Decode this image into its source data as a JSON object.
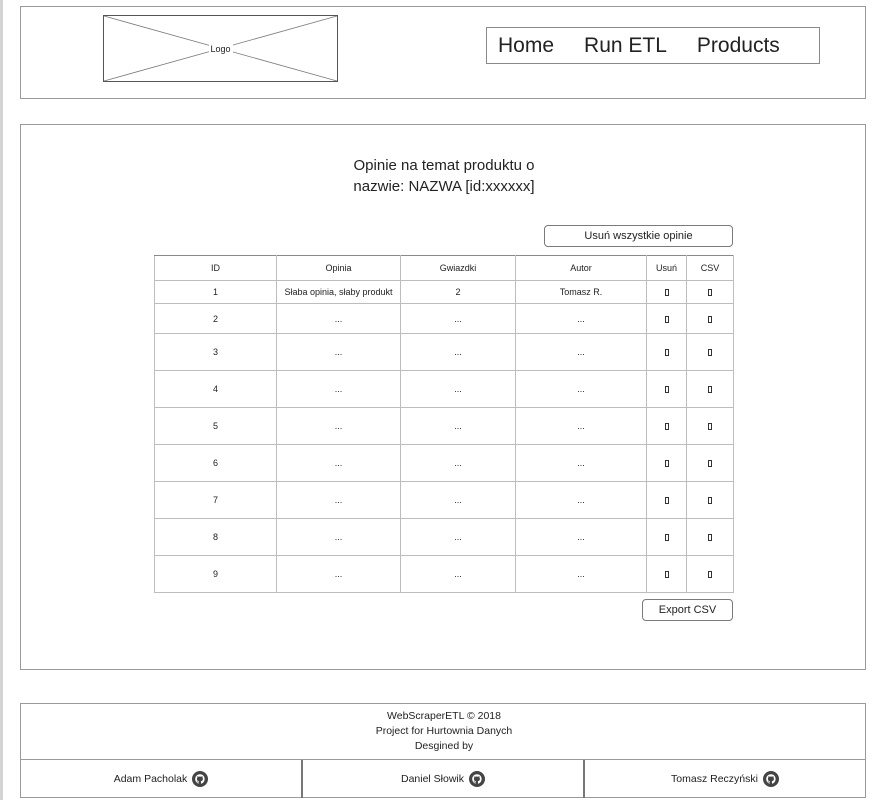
{
  "header": {
    "logo_label": "Logo",
    "nav": [
      {
        "label": "Home"
      },
      {
        "label": "Run ETL"
      },
      {
        "label": "Products"
      }
    ]
  },
  "main": {
    "title_line1": "Opinie na temat produktu o",
    "title_line2": "nazwie: NAZWA [id:xxxxxx]",
    "delete_all_label": "Usuń wszystkie opinie",
    "export_label": "Export CSV",
    "table": {
      "headers": [
        "ID",
        "Opinia",
        "Gwiazdki",
        "Autor",
        "Usuń",
        "CSV"
      ],
      "rows": [
        {
          "id": "1",
          "opinion": "Słaba opinia, słaby produkt",
          "stars": "2",
          "author": "Tomasz R."
        },
        {
          "id": "2",
          "opinion": "...",
          "stars": "...",
          "author": "..."
        },
        {
          "id": "3",
          "opinion": "...",
          "stars": "...",
          "author": "..."
        },
        {
          "id": "4",
          "opinion": "...",
          "stars": "...",
          "author": "..."
        },
        {
          "id": "5",
          "opinion": "...",
          "stars": "...",
          "author": "..."
        },
        {
          "id": "6",
          "opinion": "...",
          "stars": "...",
          "author": "..."
        },
        {
          "id": "7",
          "opinion": "...",
          "stars": "...",
          "author": "..."
        },
        {
          "id": "8",
          "opinion": "...",
          "stars": "...",
          "author": "..."
        },
        {
          "id": "9",
          "opinion": "...",
          "stars": "...",
          "author": "..."
        }
      ],
      "delete_icon": "delete-icon",
      "csv_icon": "csv-icon"
    }
  },
  "footer": {
    "line1": "WebScraperETL © 2018",
    "line2": "Project for Hurtownia Danych",
    "line3": "Desgined by",
    "authors": [
      {
        "name": "Adam Pacholak",
        "icon": "github-icon"
      },
      {
        "name": "Daniel Słowik",
        "icon": "github-icon"
      },
      {
        "name": "Tomasz Reczyński",
        "icon": "github-icon"
      }
    ]
  }
}
